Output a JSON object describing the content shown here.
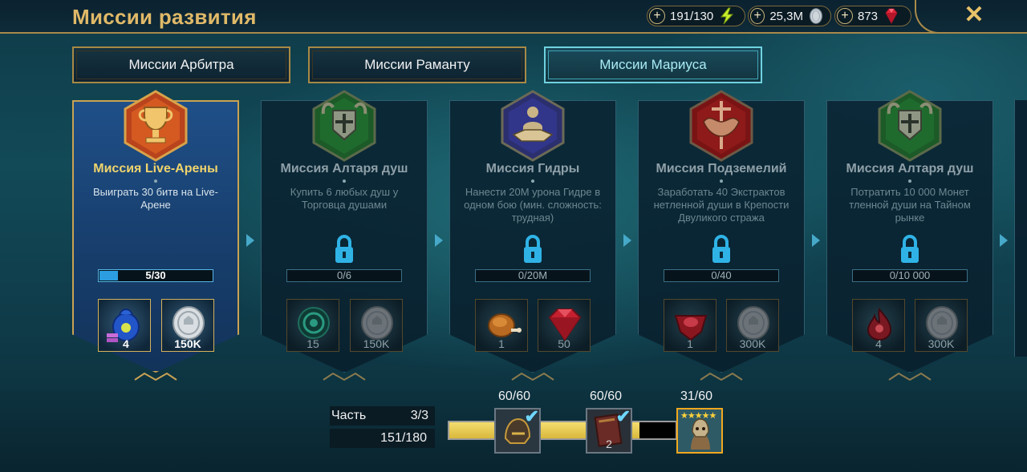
{
  "header": {
    "title": "Миссии развития",
    "resources": [
      {
        "value": "191/130",
        "icon": "energy-icon"
      },
      {
        "value": "25,3M",
        "icon": "silver-coin-icon"
      },
      {
        "value": "873",
        "icon": "gem-icon"
      }
    ],
    "plus": "+",
    "close": "✕"
  },
  "tabs": [
    {
      "label": "Миссии Арбитра",
      "active": false
    },
    {
      "label": "Миссии Раманту",
      "active": false
    },
    {
      "label": "Миссии Мариуса",
      "active": true
    }
  ],
  "missions": [
    {
      "title": "Миссия Live-Арены",
      "desc": "Выиграть 30 битв на Live-Арене",
      "progress": "5/30",
      "progress_fraction": 0.1667,
      "locked": false,
      "active": true,
      "badge_icon": "trophy-icon",
      "rewards": [
        {
          "icon": "mystery-shard-bag-icon",
          "qty": "4"
        },
        {
          "icon": "silver-coin-icon",
          "qty": "150K"
        }
      ]
    },
    {
      "title": "Миссия Алтаря душ",
      "desc": "Купить 6 любых душ у Торговца душами",
      "progress": "0/6",
      "progress_fraction": 0,
      "locked": true,
      "active": false,
      "badge_icon": "horned-helmet-icon",
      "rewards": [
        {
          "icon": "soul-orb-icon",
          "qty": "15"
        },
        {
          "icon": "silver-coin-icon",
          "qty": "150K"
        }
      ]
    },
    {
      "title": "Миссия Гидры",
      "desc": "Нанести 20M урона Гидре в одном бою (мин. сложность: трудная)",
      "progress": "0/20M",
      "progress_fraction": 0,
      "locked": true,
      "active": false,
      "badge_icon": "handshake-icon",
      "rewards": [
        {
          "icon": "chicken-icon",
          "qty": "1"
        },
        {
          "icon": "gem-icon",
          "qty": "50"
        }
      ]
    },
    {
      "title": "Миссия Подземелий",
      "desc": "Заработать 40 Экстрактов нетленной души в Крепости Двуликого стража",
      "progress": "0/40",
      "progress_fraction": 0,
      "locked": true,
      "active": false,
      "badge_icon": "dungeon-crest-icon",
      "rewards": [
        {
          "icon": "essence-icon",
          "qty": "1"
        },
        {
          "icon": "silver-coin-icon",
          "qty": "300K"
        }
      ]
    },
    {
      "title": "Миссия Алтаря душ",
      "desc": "Потратить 10 000 Монет тленной души на Тайном рынке",
      "progress": "0/10 000",
      "progress_fraction": 0,
      "locked": true,
      "active": false,
      "badge_icon": "horned-helmet-icon",
      "rewards": [
        {
          "icon": "soul-flame-icon",
          "qty": "4"
        },
        {
          "icon": "silver-coin-icon",
          "qty": "300K"
        }
      ]
    }
  ],
  "bottom": {
    "part_label": "Часть",
    "part_value": "3/3",
    "points": "151/180",
    "bar_fraction": 0.8389,
    "milestones": [
      {
        "label": "60/60",
        "icon": "helmet-reward-icon",
        "qty": "",
        "claimed": true
      },
      {
        "label": "60/60",
        "icon": "tome-reward-icon",
        "qty": "2",
        "claimed": true
      },
      {
        "label": "31/60",
        "icon": "champion-portrait-icon",
        "qty": "",
        "claimed": false,
        "stars": "★★★★★"
      }
    ]
  },
  "colors": {
    "gold": "#e0b968",
    "active_tab": "#6fd2e0",
    "lock": "#2fb3e6",
    "progress": "#2b9de0",
    "milestone_bar": "#e8c94f"
  }
}
